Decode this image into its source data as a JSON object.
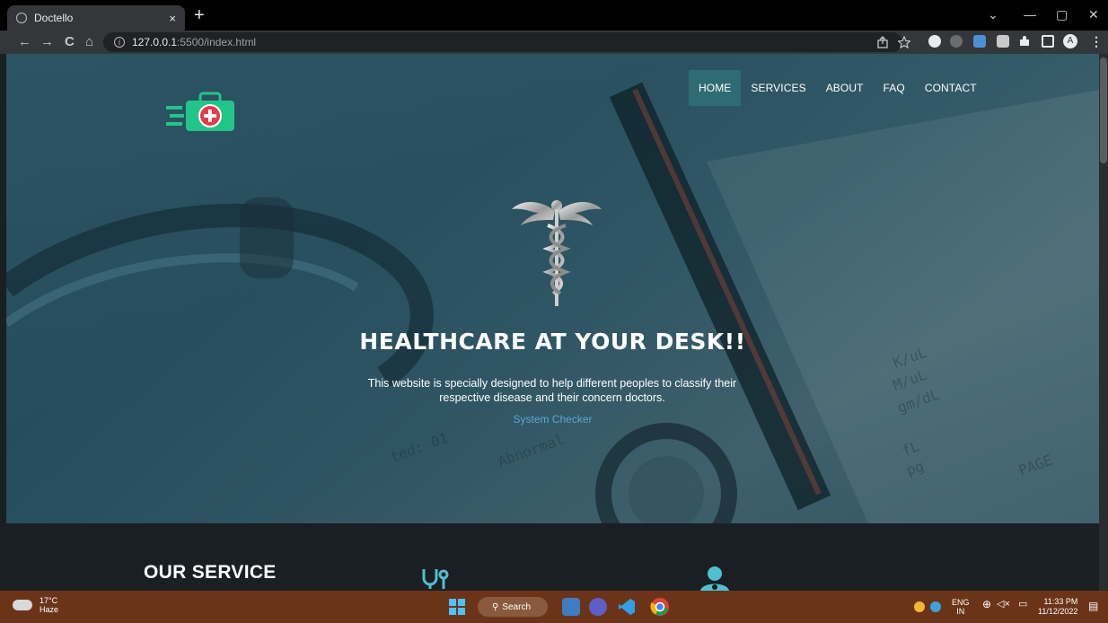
{
  "browser": {
    "tab_title": "Doctello",
    "tab_close": "×",
    "new_tab": "+",
    "url_host": "127.0.0.1",
    "url_path": ":5500/index.html",
    "back": "←",
    "forward": "→",
    "reload": "C",
    "home": "⌂",
    "window_controls": [
      "⌄",
      "—",
      "▢",
      "✕"
    ]
  },
  "site": {
    "nav": [
      "HOME",
      "SERVICES",
      "ABOUT",
      "FAQ",
      "CONTACT"
    ],
    "active_nav": "HOME",
    "hero_title": "HEALTHCARE AT YOUR DESK!!",
    "hero_desc": "This website is specially designed to help different peoples to classify their respective disease and their concern doctors.",
    "hero_link": "System Checker",
    "section_title": "OUR SERVICE"
  },
  "taskbar": {
    "temp": "17°C",
    "weather": "Haze",
    "search": "Search",
    "lang_top": "ENG",
    "lang_bottom": "IN",
    "time": "11:33 PM",
    "date": "11/12/2022"
  },
  "colors": {
    "accent_teal": "#2f6b73",
    "link_blue": "#5aa7d6",
    "logo_green": "#23c48a",
    "logo_red": "#e8394b",
    "taskbar": "#6b3418"
  }
}
